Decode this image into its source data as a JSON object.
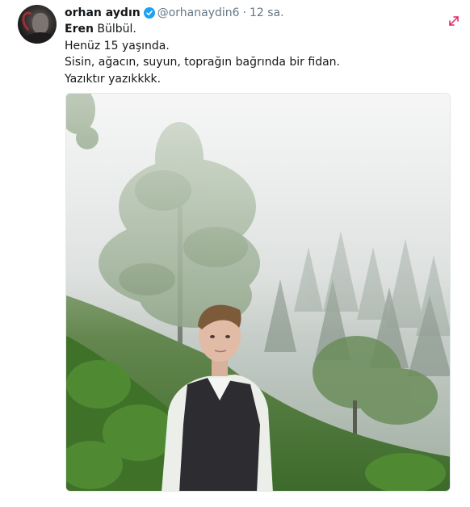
{
  "tweet": {
    "display_name": "orhan aydın",
    "handle": "@orhanaydin6",
    "separator": "·",
    "time": "12 sa.",
    "verified": true,
    "text": {
      "mention_bold": "Eren",
      "mention_rest": " Bülbül.",
      "line2": "Henüz 15 yaşında.",
      "line3": "Sisin, ağacın, suyun, toprağın bağrında bir fidan.",
      "line4": "Yazıktır yazıkkkk."
    },
    "media": {
      "icon": "photo-of-young-man-in-misty-forest"
    }
  },
  "icons": {
    "verified": "verified-badge-icon",
    "expand": "expand-icon"
  },
  "colors": {
    "verified_blue": "#1da1f2",
    "expand_pink": "#e0245e",
    "secondary_text": "#657786",
    "primary_text": "#14171a"
  }
}
